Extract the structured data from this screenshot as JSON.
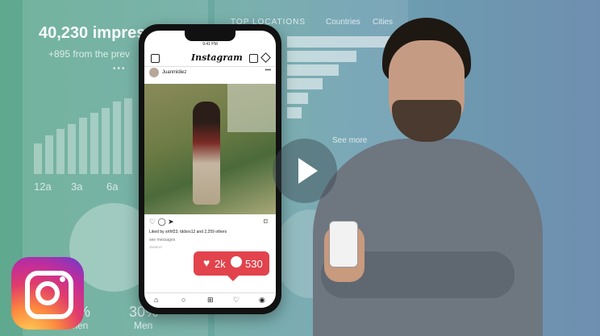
{
  "analytics": {
    "impressions": "40,230 impres",
    "impressions_delta": "+895 from the prev",
    "dots": "•••",
    "time_ticks": [
      "12a",
      "3a",
      "6a"
    ],
    "gender": [
      {
        "pct": "%",
        "label": "men"
      },
      {
        "pct": "30%",
        "label": "Men"
      }
    ],
    "top_locations_label": "TOP LOCATIONS",
    "location_tabs": [
      "Countries",
      "Cities"
    ],
    "see_more": "See more"
  },
  "phone": {
    "time": "9:41 PM",
    "app_name": "Instagram",
    "username": "Juanmidiez",
    "more": "•••",
    "actions": "♡ ◯ ➤",
    "bookmark": "⌑",
    "liked_by": "Liked by srthf23, tddsrs12 and 2,259 others",
    "see_messages": "see messages",
    "date": "25/05/19",
    "nav_icons": [
      "home-icon",
      "search-icon",
      "add-icon",
      "heart-icon",
      "profile-icon"
    ]
  },
  "badge": {
    "likes": "2k",
    "comments": "530",
    "color": "#e2434c"
  },
  "icons": {
    "play": "play-icon",
    "instagram": "instagram-logo-icon"
  }
}
